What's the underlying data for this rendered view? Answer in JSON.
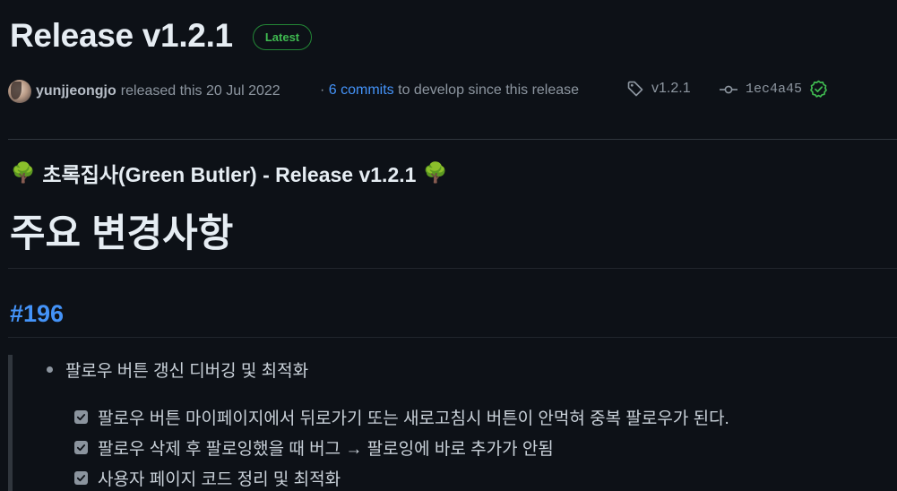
{
  "release": {
    "title": "Release v1.2.1",
    "badge": "Latest"
  },
  "meta": {
    "author": "yunjjeongjo",
    "released_text": "released this 20 Jul 2022",
    "commits_prefix": "·",
    "commits_link": "6 commits",
    "commits_suffix": "to develop since this release",
    "tag": "v1.2.1",
    "commit_sha": "1ec4a45",
    "icons": {
      "tag": "tag-icon",
      "commit": "git-commit-icon",
      "verified": "check-circle-icon"
    },
    "colors": {
      "link": "#4493f8",
      "verified": "#3fb950"
    }
  },
  "body": {
    "title_emoji": "🌳",
    "title": "초록집사(Green Butler) - Release v1.2.1",
    "heading": "주요 변경사항",
    "issue_link": "#196",
    "bullet": "팔로우 버튼 갱신 디버깅 및 최적화",
    "tasks": [
      {
        "label": "팔로우 버튼 마이페이지에서 뒤로가기 또는 새로고침시 버튼이 안먹혀 중복 팔로우가 된다.",
        "checked": true
      },
      {
        "label": "팔로우 삭제 후 팔로잉했을 때 버그 → 팔로잉에 바로 추가가 안됨",
        "checked": true
      },
      {
        "label": "사용자 페이지 코드 정리 및 최적화",
        "checked": true
      }
    ]
  }
}
